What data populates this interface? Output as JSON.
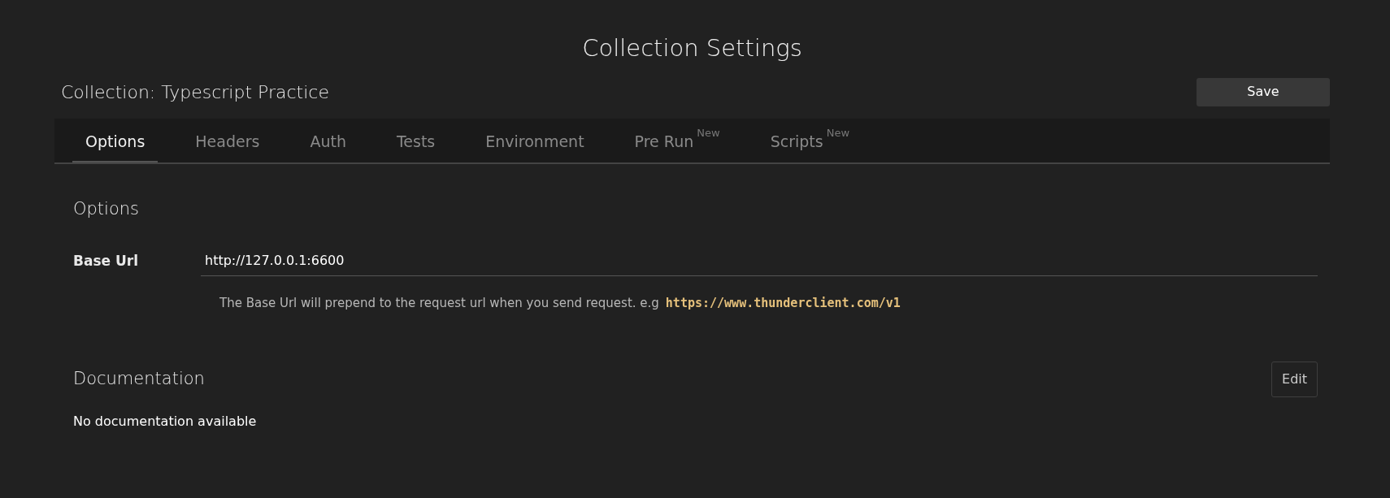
{
  "page_title": "Collection Settings",
  "collection_label": "Collection: Typescript Practice",
  "save_button": "Save",
  "tabs": [
    {
      "label": "Options",
      "selected": true
    },
    {
      "label": "Headers",
      "selected": false
    },
    {
      "label": "Auth",
      "selected": false
    },
    {
      "label": "Tests",
      "selected": false
    },
    {
      "label": "Environment",
      "selected": false
    },
    {
      "label": "Pre Run",
      "selected": false,
      "badge": "New"
    },
    {
      "label": "Scripts",
      "selected": false,
      "badge": "New"
    }
  ],
  "options": {
    "heading": "Options",
    "base_url": {
      "label": "Base Url",
      "value": "http://127.0.0.1:6600",
      "help": "The Base Url will prepend to the request url when you send request. e.g",
      "example": "https://www.thunderclient.com/v1"
    }
  },
  "documentation": {
    "heading": "Documentation",
    "edit_button": "Edit",
    "text": "No documentation available"
  }
}
